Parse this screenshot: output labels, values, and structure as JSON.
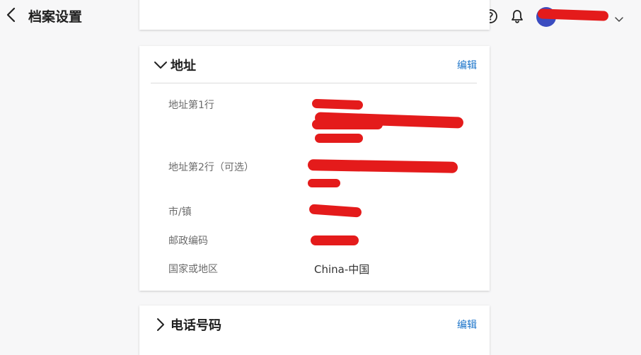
{
  "header": {
    "title": "档案设置",
    "back_icon": "chevron-left-icon",
    "help_icon": "help-circle-icon",
    "bell_icon": "bell-icon",
    "user_name": "",
    "user_menu_icon": "chevron-down-icon",
    "avatar_color": "#3b4cc0"
  },
  "address_section": {
    "title": "地址",
    "expanded": true,
    "edit_label": "编辑",
    "fields": [
      {
        "label": "地址第1行",
        "value": ""
      },
      {
        "label": "地址第2行（可选）",
        "value": ""
      },
      {
        "label": "市/镇",
        "value": ""
      },
      {
        "label": "邮政编码",
        "value": ""
      },
      {
        "label": "国家或地区",
        "value": "China-中国"
      }
    ]
  },
  "phone_section": {
    "title": "电话号码",
    "expanded": false,
    "edit_label": "编辑"
  },
  "colors": {
    "accent": "#1a73c9",
    "redaction": "#e41b1b"
  }
}
